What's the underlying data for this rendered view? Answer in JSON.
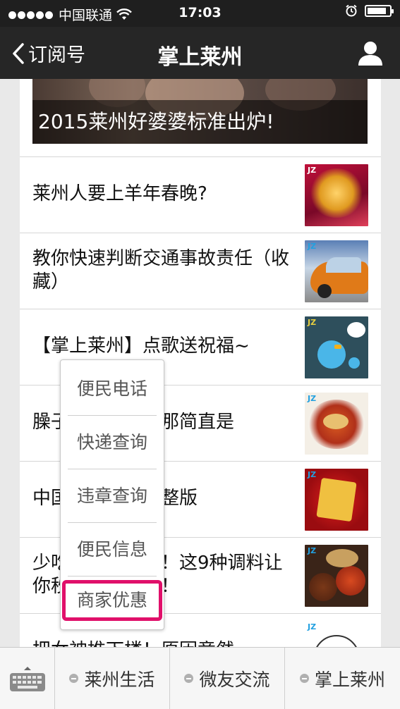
{
  "status_bar": {
    "carrier": "中国联通",
    "time": "17:03",
    "battery_level": 0.85
  },
  "nav": {
    "back_label": "订阅号",
    "title": "掌上莱州"
  },
  "hero": {
    "caption": "2015莱州好婆婆标准出炉!"
  },
  "articles": [
    {
      "title": "莱州人要上羊年春晚?",
      "thumb": "spring-festival-gala-icon"
    },
    {
      "title": "教你快速判断交通事故责任（收藏）",
      "thumb": "car-accident-photo"
    },
    {
      "title": "【掌上莱州】点歌送祝福~",
      "thumb": "bird-icon"
    },
    {
      "title": "臊子面这样做，那简直是",
      "thumb": "noodles-photo"
    },
    {
      "title": "中国春节民俗完整版",
      "thumb": "spring-character-photo"
    },
    {
      "title": "少吃调料是错的！这9种调料让你秒变厨房高手！",
      "thumb": "spices-photo"
    },
    {
      "title": "把女神推下楼！原因竟然",
      "thumb": "cartoon-face-photo"
    }
  ],
  "menu": {
    "items": [
      "便民电话",
      "快递查询",
      "违章查询",
      "便民信息",
      "商家优惠"
    ],
    "highlighted_index": 4
  },
  "bottom_tabs": [
    "莱州生活",
    "微友交流",
    "掌上莱州"
  ],
  "colors": {
    "nav_bg": "#262626",
    "highlight": "#e0106a"
  }
}
